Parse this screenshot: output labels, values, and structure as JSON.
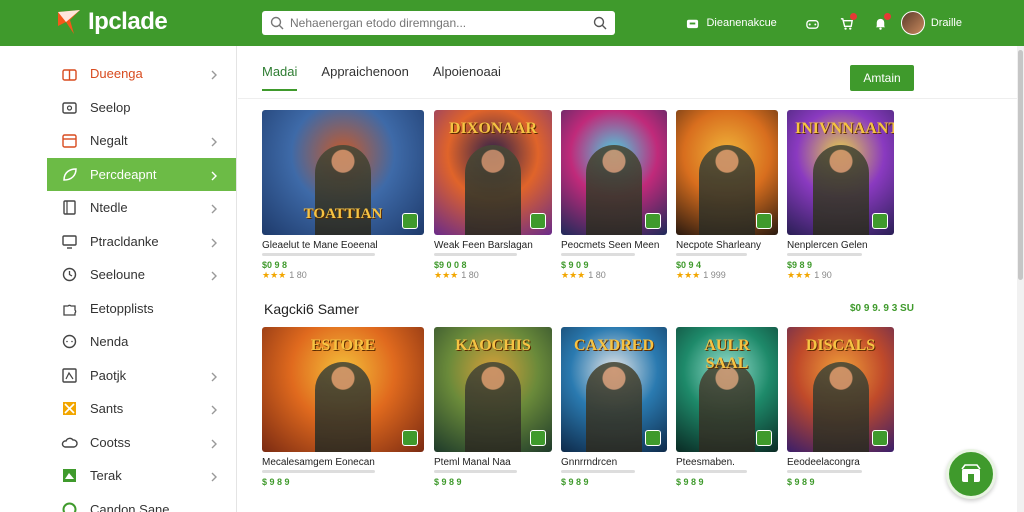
{
  "app": {
    "name": "Ipclade"
  },
  "search": {
    "placeholder": "Nehaenergan etodo diremngan..."
  },
  "header": {
    "primary_action": "Dieanenakcue",
    "user_name": "Draille"
  },
  "sidebar": {
    "items": [
      {
        "label": "Dueenga",
        "icon": "gift-icon",
        "chevron": true
      },
      {
        "label": "Seelop",
        "icon": "store-icon",
        "chevron": false
      },
      {
        "label": "Negalt",
        "icon": "calendar-icon",
        "chevron": true
      },
      {
        "label": "Percdeapnt",
        "icon": "leaf-icon",
        "chevron": true,
        "active": true
      },
      {
        "label": "Ntedle",
        "icon": "book-icon",
        "chevron": true
      },
      {
        "label": "Ptracldanke",
        "icon": "monitor-icon",
        "chevron": true
      },
      {
        "label": "Seeloune",
        "icon": "clock-icon",
        "chevron": true
      },
      {
        "label": "Eetopplists",
        "icon": "puzzle-icon",
        "chevron": false
      },
      {
        "label": "Nenda",
        "icon": "chat-icon",
        "chevron": false
      },
      {
        "label": "Paotjk",
        "icon": "frame-icon",
        "chevron": true
      },
      {
        "label": "Sants",
        "icon": "grid-icon",
        "chevron": true
      },
      {
        "label": "Cootss",
        "icon": "cloud-icon",
        "chevron": true
      },
      {
        "label": "Terak",
        "icon": "image-icon",
        "chevron": true
      },
      {
        "label": "Candon Sane",
        "icon": "coin-icon",
        "chevron": false
      }
    ]
  },
  "tabs": [
    {
      "label": "Madai",
      "active": true
    },
    {
      "label": "Appraichenoon"
    },
    {
      "label": "Alpoienoaai"
    }
  ],
  "action_button": "Amtain",
  "row1": [
    {
      "title": "Gleaelut te Mane Eoeenal",
      "price": "$0 9 8",
      "reviews": "1 80",
      "art_text": "TOATTIAN",
      "palette": [
        "#1e3a6b",
        "#3e6aa8",
        "#c65a2a"
      ]
    },
    {
      "title": "Weak Feen Barslagan",
      "price": "$9 0 0 8",
      "reviews": "1 80",
      "art_text": "DIXONAAR",
      "palette": [
        "#6a2b8a",
        "#e0642a",
        "#2a1f4a"
      ]
    },
    {
      "title": "Peocmets Seen Meen",
      "price": "$ 9 0 9",
      "reviews": "1 80",
      "art_text": "",
      "palette": [
        "#1f2a5a",
        "#c02a7a",
        "#4ad0e0"
      ]
    },
    {
      "title": "Necpote Sharleany",
      "price": "$0 9 4",
      "reviews": "1 999",
      "art_text": "",
      "palette": [
        "#2a1a10",
        "#d86e1e",
        "#f0b43a"
      ]
    },
    {
      "title": "Nenplercen Gelen",
      "price": "$9 8 9",
      "reviews": "1 90",
      "art_text": "INIVNNAANT",
      "palette": [
        "#2a1f55",
        "#8a3ac0",
        "#e8d24a"
      ]
    }
  ],
  "section": {
    "title": "Kagcki6 Samer",
    "link": "$0 9 9. 9 3 SU"
  },
  "row2": [
    {
      "title": "Mecalesamgem Eonecan",
      "price": "$ 9 8 9",
      "art_text": "ESTORE",
      "palette": [
        "#7a2a12",
        "#e06a1e",
        "#f4c03a"
      ]
    },
    {
      "title": "Pteml Manal Naa",
      "price": "$ 9 8 9",
      "art_text": "KAOCHIS",
      "palette": [
        "#1e3a2a",
        "#6a8a3a",
        "#d8a03a"
      ]
    },
    {
      "title": "Gnnrrndrcen",
      "price": "$ 9 8 9",
      "art_text": "CAXDRED",
      "palette": [
        "#0e2a4a",
        "#2a7ab0",
        "#e8e8e8"
      ]
    },
    {
      "title": "Pteesmaben.",
      "price": "$ 9 8 9",
      "art_text": "AULR SAAL",
      "palette": [
        "#0a2a24",
        "#1e8a6a",
        "#9ae0d0"
      ]
    },
    {
      "title": "Eeodeelacongra",
      "price": "$ 9 8 9",
      "art_text": "DISCALS",
      "palette": [
        "#3a1e6a",
        "#c04a2a",
        "#f0a03a"
      ]
    }
  ],
  "colors": {
    "brand": "#3f9a2c",
    "active_item": "#6cbb46",
    "rating": "#f2a600"
  }
}
